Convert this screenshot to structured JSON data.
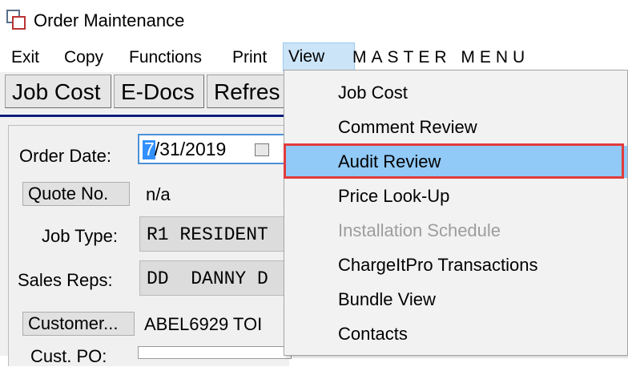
{
  "window": {
    "title": "Order Maintenance"
  },
  "menubar": {
    "items": [
      "Exit",
      "Copy",
      "Functions",
      "Print",
      "View"
    ],
    "master_label": "MASTER MENU"
  },
  "toolbar": {
    "buttons": [
      "Job Cost",
      "E-Docs",
      "Refres"
    ]
  },
  "form": {
    "order_date_label": "Order Date:",
    "order_date_first": "7",
    "order_date_rest": "/31/2019",
    "quote_button": "Quote No.",
    "quote_value": "n/a",
    "job_type_label": "Job Type:",
    "job_type_value": "R1 RESIDENT",
    "sales_reps_label": "Sales Reps:",
    "sales_reps_value": "DD  DANNY D",
    "customer_button": "Customer...",
    "customer_value": "ABEL6929  TOI",
    "cust_po_label": "Cust. PO:"
  },
  "view_menu": {
    "items": [
      {
        "label": "Job Cost",
        "enabled": true
      },
      {
        "label": "Comment Review",
        "enabled": true
      },
      {
        "label": "Audit Review",
        "enabled": true,
        "highlighted": true
      },
      {
        "label": "Price Look-Up",
        "enabled": true
      },
      {
        "label": "Installation Schedule",
        "enabled": false
      },
      {
        "label": "ChargeItPro Transactions",
        "enabled": true
      },
      {
        "label": "Bundle View",
        "enabled": true
      },
      {
        "label": "Contacts",
        "enabled": true
      }
    ]
  },
  "colors": {
    "highlight": "#91c9f7",
    "annotation": "#e23b3b",
    "menu_active": "#cce4f7"
  }
}
